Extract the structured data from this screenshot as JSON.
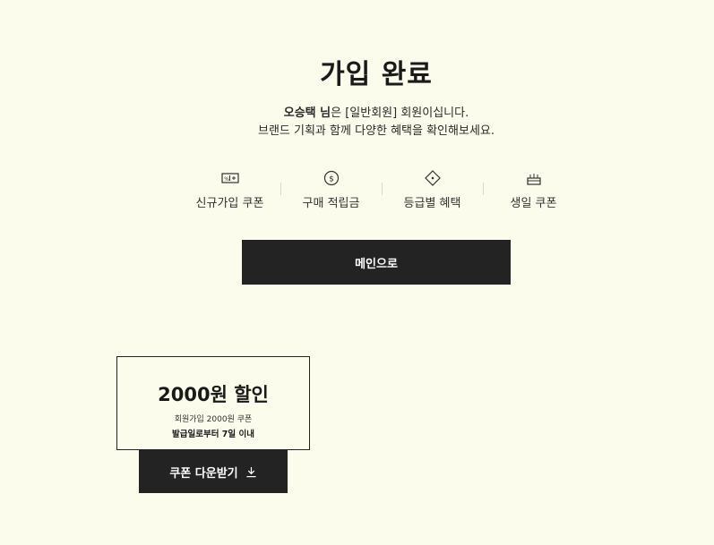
{
  "header": {
    "title": "가입 완료"
  },
  "message": {
    "user_name": "오승택 님",
    "line1_rest": "은 [일반회원] 회원이십니다.",
    "line2": "브랜드 기획과 함께 다양한 혜택을 확인해보세요."
  },
  "benefits": [
    {
      "label": "신규가입 쿠폰",
      "icon": "coupon-icon"
    },
    {
      "label": "구매 적립금",
      "icon": "dollar-coin-icon"
    },
    {
      "label": "등급별 혜택",
      "icon": "diamond-icon"
    },
    {
      "label": "생일 쿠폰",
      "icon": "cake-icon"
    }
  ],
  "main_button": {
    "label": "메인으로"
  },
  "coupon": {
    "amount": "2000원 할인",
    "description": "회원가입 2000원 쿠폰",
    "validity": "발급일로부터 7일 이내",
    "download_label": "쿠폰 다운받기",
    "download_icon": "download-icon"
  },
  "colors": {
    "background": "#fbfcec",
    "button": "#232323",
    "text": "#1e1e1e"
  }
}
